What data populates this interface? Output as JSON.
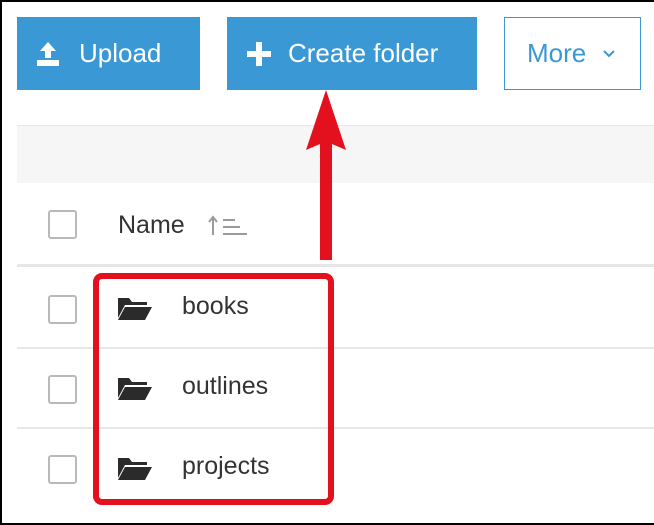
{
  "toolbar": {
    "upload_label": "Upload",
    "create_folder_label": "Create folder",
    "more_label": "More"
  },
  "table": {
    "name_header": "Name",
    "rows": [
      {
        "name": "books",
        "icon": "folder-open-icon"
      },
      {
        "name": "outlines",
        "icon": "folder-open-icon"
      },
      {
        "name": "projects",
        "icon": "folder-open-icon"
      }
    ]
  },
  "annotation": {
    "color": "#e3101d"
  },
  "colors": {
    "accent": "#3a98d4",
    "text": "#333333",
    "border": "#b9b9b9"
  }
}
